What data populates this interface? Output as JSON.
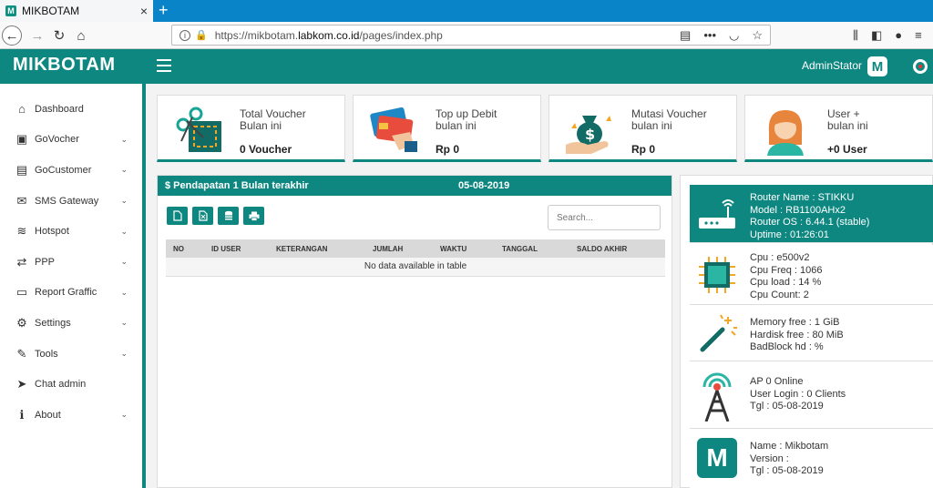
{
  "browser": {
    "tab_title": "MIKBOTAM",
    "tab_favicon": "M",
    "tab_close": "×",
    "newtab": "+",
    "url_prefix": "https://mikbotam.",
    "url_host": "labkom.co.id",
    "url_path": "/pages/index.php"
  },
  "header": {
    "brand": "MIKBOTAM",
    "user": "AdminStator",
    "logo_letter": "M"
  },
  "sidebar": {
    "items": [
      {
        "label": "Dashboard",
        "icon": "home-icon",
        "glyph": "⌂",
        "chevron": false
      },
      {
        "label": "GoVocher",
        "icon": "ticket-icon",
        "glyph": "▣",
        "chevron": true
      },
      {
        "label": "GoCustomer",
        "icon": "id-card-icon",
        "glyph": "▤",
        "chevron": true
      },
      {
        "label": "SMS Gateway",
        "icon": "envelope-icon",
        "glyph": "✉",
        "chevron": true
      },
      {
        "label": "Hotspot",
        "icon": "wifi-icon",
        "glyph": "≋",
        "chevron": true
      },
      {
        "label": "PPP",
        "icon": "retweet-icon",
        "glyph": "⇄",
        "chevron": true
      },
      {
        "label": "Report Graffic",
        "icon": "monitor-icon",
        "glyph": "▭",
        "chevron": true
      },
      {
        "label": "Settings",
        "icon": "gears-icon",
        "glyph": "⚙",
        "chevron": true
      },
      {
        "label": "Tools",
        "icon": "wrench-icon",
        "glyph": "✎",
        "chevron": true
      },
      {
        "label": "Chat admin",
        "icon": "paper-plane-icon",
        "glyph": "➤",
        "chevron": false
      },
      {
        "label": "About",
        "icon": "info-icon",
        "glyph": "ℹ",
        "chevron": true
      }
    ]
  },
  "cards": [
    {
      "title1": "Total Voucher",
      "title2": "Bulan ini",
      "value": "0 Voucher",
      "icon": "voucher-icon"
    },
    {
      "title1": "Top up Debit",
      "title2": "bulan ini",
      "value": "Rp 0",
      "icon": "credit-card-icon"
    },
    {
      "title1": "Mutasi Voucher",
      "title2": "bulan ini",
      "value": "Rp 0",
      "icon": "money-bag-icon"
    },
    {
      "title1": "User +",
      "title2": "bulan ini",
      "value": "+0 User",
      "icon": "user-avatar-icon"
    }
  ],
  "income_panel": {
    "title": "$ Pendapatan 1 Bulan terakhir",
    "date": "05-08-2019",
    "search_placeholder": "Search...",
    "columns": [
      "NO",
      "ID USER",
      "KETERANGAN",
      "JUMLAH",
      "WAKTU",
      "TANGGAL",
      "SALDO AKHIR"
    ],
    "empty_message": "No data available in table"
  },
  "router_panel": {
    "router": [
      "Router Name : STIKKU",
      "Model : RB1100AHx2",
      "Router OS : 6.44.1 (stable)",
      "Uptime : 01:26:01"
    ],
    "cpu": [
      "Cpu : e500v2",
      "Cpu Freq : 1066",
      "Cpu load : 14 %",
      "Cpu Count: 2"
    ],
    "memory": [
      "Memory free : 1 GiB",
      "Hardisk free : 80 MiB",
      "BadBlock hd : %"
    ],
    "ap": [
      "AP 0 Online",
      "User Login : 0 Clients",
      "Tgl : 05-08-2019"
    ],
    "app": [
      "Name : Mikbotam",
      "Version :",
      "Tgl : 05-08-2019"
    ],
    "app_logo": "M"
  },
  "colors": {
    "primary": "#0e8780",
    "browser_tab": "#0a84c8"
  }
}
